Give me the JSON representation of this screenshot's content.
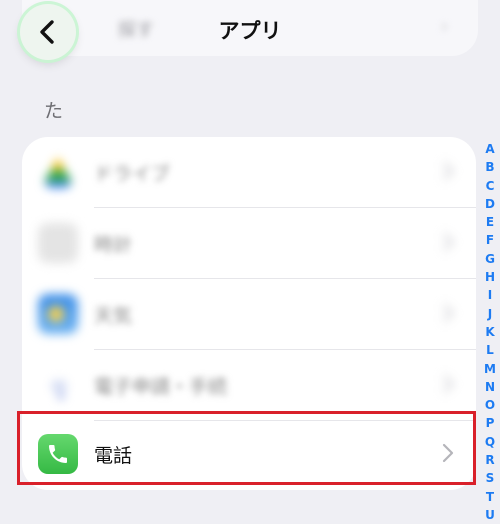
{
  "header": {
    "title": "アプリ",
    "prev_row_label": "探す"
  },
  "section": {
    "header": "た"
  },
  "rows": [
    {
      "label": "ドライブ",
      "icon": "drive-icon",
      "blurred": true
    },
    {
      "label": "時計",
      "icon": "clock-icon",
      "blurred": true
    },
    {
      "label": "天気",
      "icon": "weather-icon",
      "blurred": true
    },
    {
      "label": "電子申請・手続",
      "icon": "form-icon",
      "blurred": true
    },
    {
      "label": "電話",
      "icon": "phone-icon",
      "blurred": false
    }
  ],
  "index": [
    "A",
    "B",
    "C",
    "D",
    "E",
    "F",
    "G",
    "H",
    "I",
    "J",
    "K",
    "L",
    "M",
    "N",
    "O",
    "P",
    "Q",
    "R",
    "S",
    "T",
    "U"
  ],
  "colors": {
    "accent": "#1d7bf2",
    "highlight": "#d9202a",
    "phone_green": "#4cd964"
  }
}
